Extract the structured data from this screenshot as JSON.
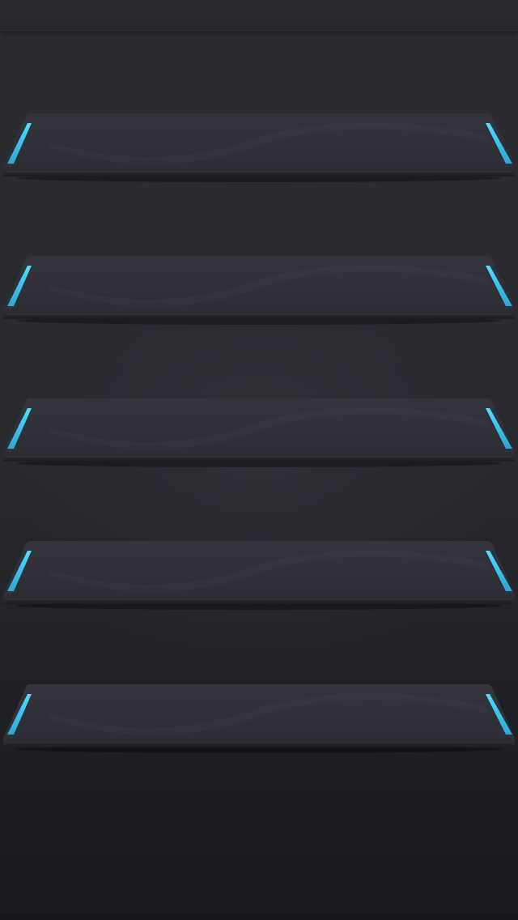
{
  "screen": {
    "name": "home-screen-shelves-wallpaper"
  },
  "theme": {
    "background_top": "#2c2d33",
    "background_bottom": "#18191d",
    "shelf_surface": "#2f3037",
    "shelf_edge": "#1f2025",
    "accent": "#39c8f0"
  },
  "shelves": [
    {
      "index": 1
    },
    {
      "index": 2
    },
    {
      "index": 3
    },
    {
      "index": 4
    },
    {
      "index": 5
    }
  ]
}
